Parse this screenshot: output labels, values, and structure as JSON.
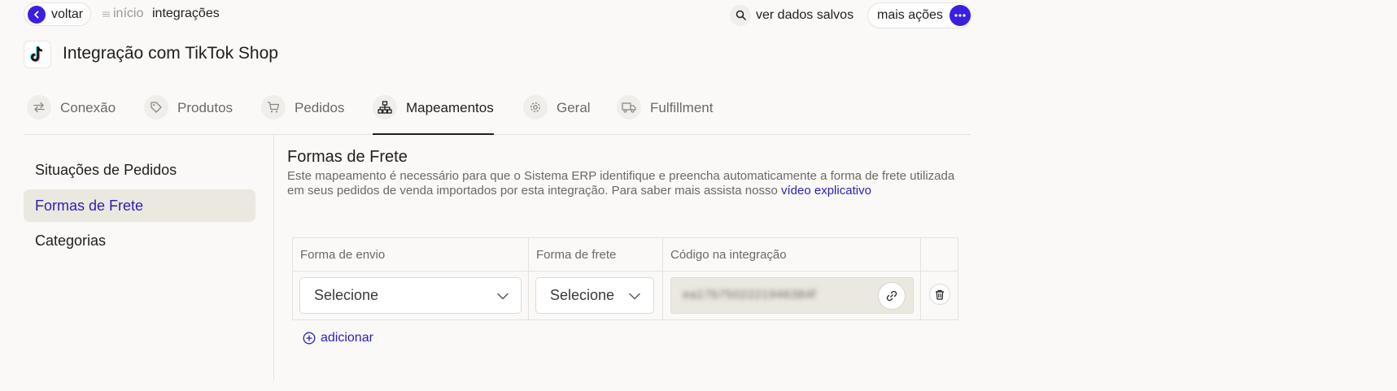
{
  "topbar": {
    "back_label": "voltar",
    "breadcrumb_home": "início",
    "breadcrumb_current": "integrações",
    "saved_label": "ver dados salvos",
    "more_label": "mais ações"
  },
  "page": {
    "title": "Integração com TikTok Shop",
    "logo_icon": "tiktok-logo"
  },
  "tabs": [
    {
      "label": "Conexão",
      "icon": "arrows-swap-icon",
      "active": false
    },
    {
      "label": "Produtos",
      "icon": "tag-icon",
      "active": false
    },
    {
      "label": "Pedidos",
      "icon": "cart-icon",
      "active": false
    },
    {
      "label": "Mapeamentos",
      "icon": "hierarchy-icon",
      "active": true
    },
    {
      "label": "Geral",
      "icon": "gear-icon",
      "active": false
    },
    {
      "label": "Fulfillment",
      "icon": "truck-icon",
      "active": false
    }
  ],
  "sidebar": {
    "items": [
      {
        "label": "Situações de Pedidos",
        "active": false
      },
      {
        "label": "Formas de Frete",
        "active": true
      },
      {
        "label": "Categorias",
        "active": false
      }
    ]
  },
  "section": {
    "title": "Formas de Frete",
    "description": "Este mapeamento é necessário para que o Sistema ERP identifique e preencha automaticamente a forma de frete utilizada em seus pedidos de venda importados por esta integração. Para saber mais assista nosso ",
    "link_label": "vídeo explicativo"
  },
  "table": {
    "headers": [
      "Forma de envio",
      "Forma de frete",
      "Código na integração"
    ],
    "rows": [
      {
        "forma_envio": "Selecione",
        "forma_frete": "Selecione",
        "codigo": "ea17b7502221946384f"
      }
    ]
  },
  "actions": {
    "add_label": "adicionar"
  },
  "colors": {
    "accent": "#3b1fe0",
    "link": "#2b1fb8",
    "background": "#faf9f7",
    "sidebar_active": "#ebe8df"
  }
}
